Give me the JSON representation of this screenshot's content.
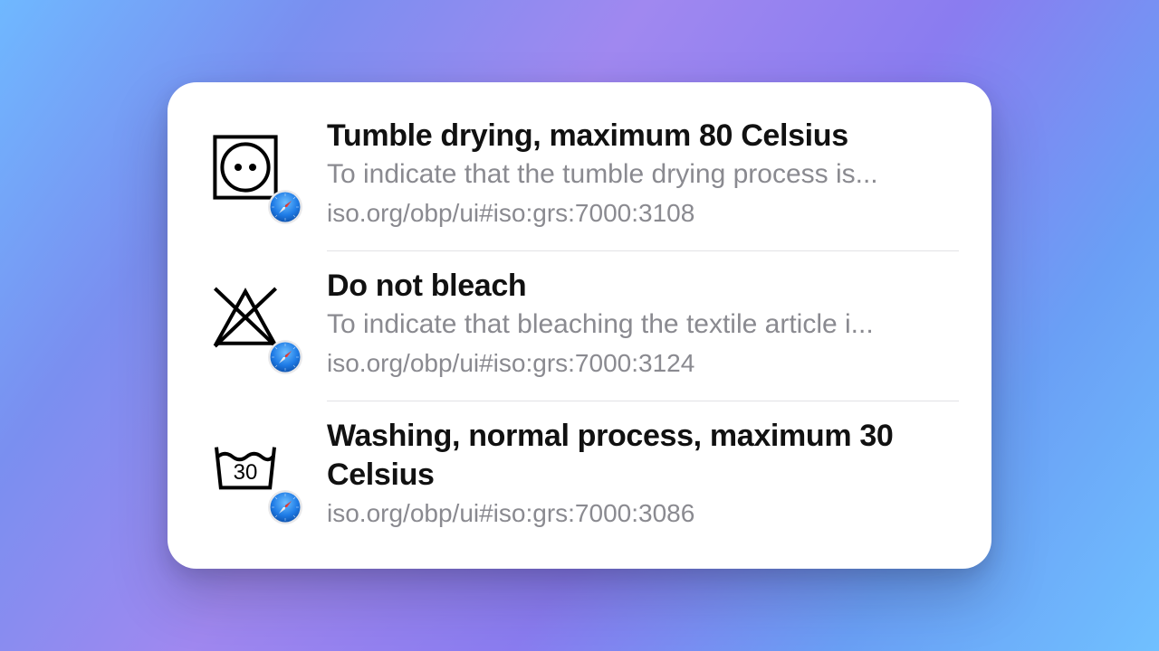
{
  "results": [
    {
      "symbol": "tumble-dry-80",
      "title": "Tumble drying, maximum 80 Celsius",
      "description": "To indicate that the tumble drying process is...",
      "url": "iso.org/obp/ui#iso:grs:7000:3108"
    },
    {
      "symbol": "do-not-bleach",
      "title": "Do not bleach",
      "description": "To indicate that bleaching the textile article i...",
      "url": "iso.org/obp/ui#iso:grs:7000:3124"
    },
    {
      "symbol": "wash-30",
      "title": "Washing, normal process, maximum 30 Celsius",
      "description": "",
      "url": "iso.org/obp/ui#iso:grs:7000:3086"
    }
  ]
}
